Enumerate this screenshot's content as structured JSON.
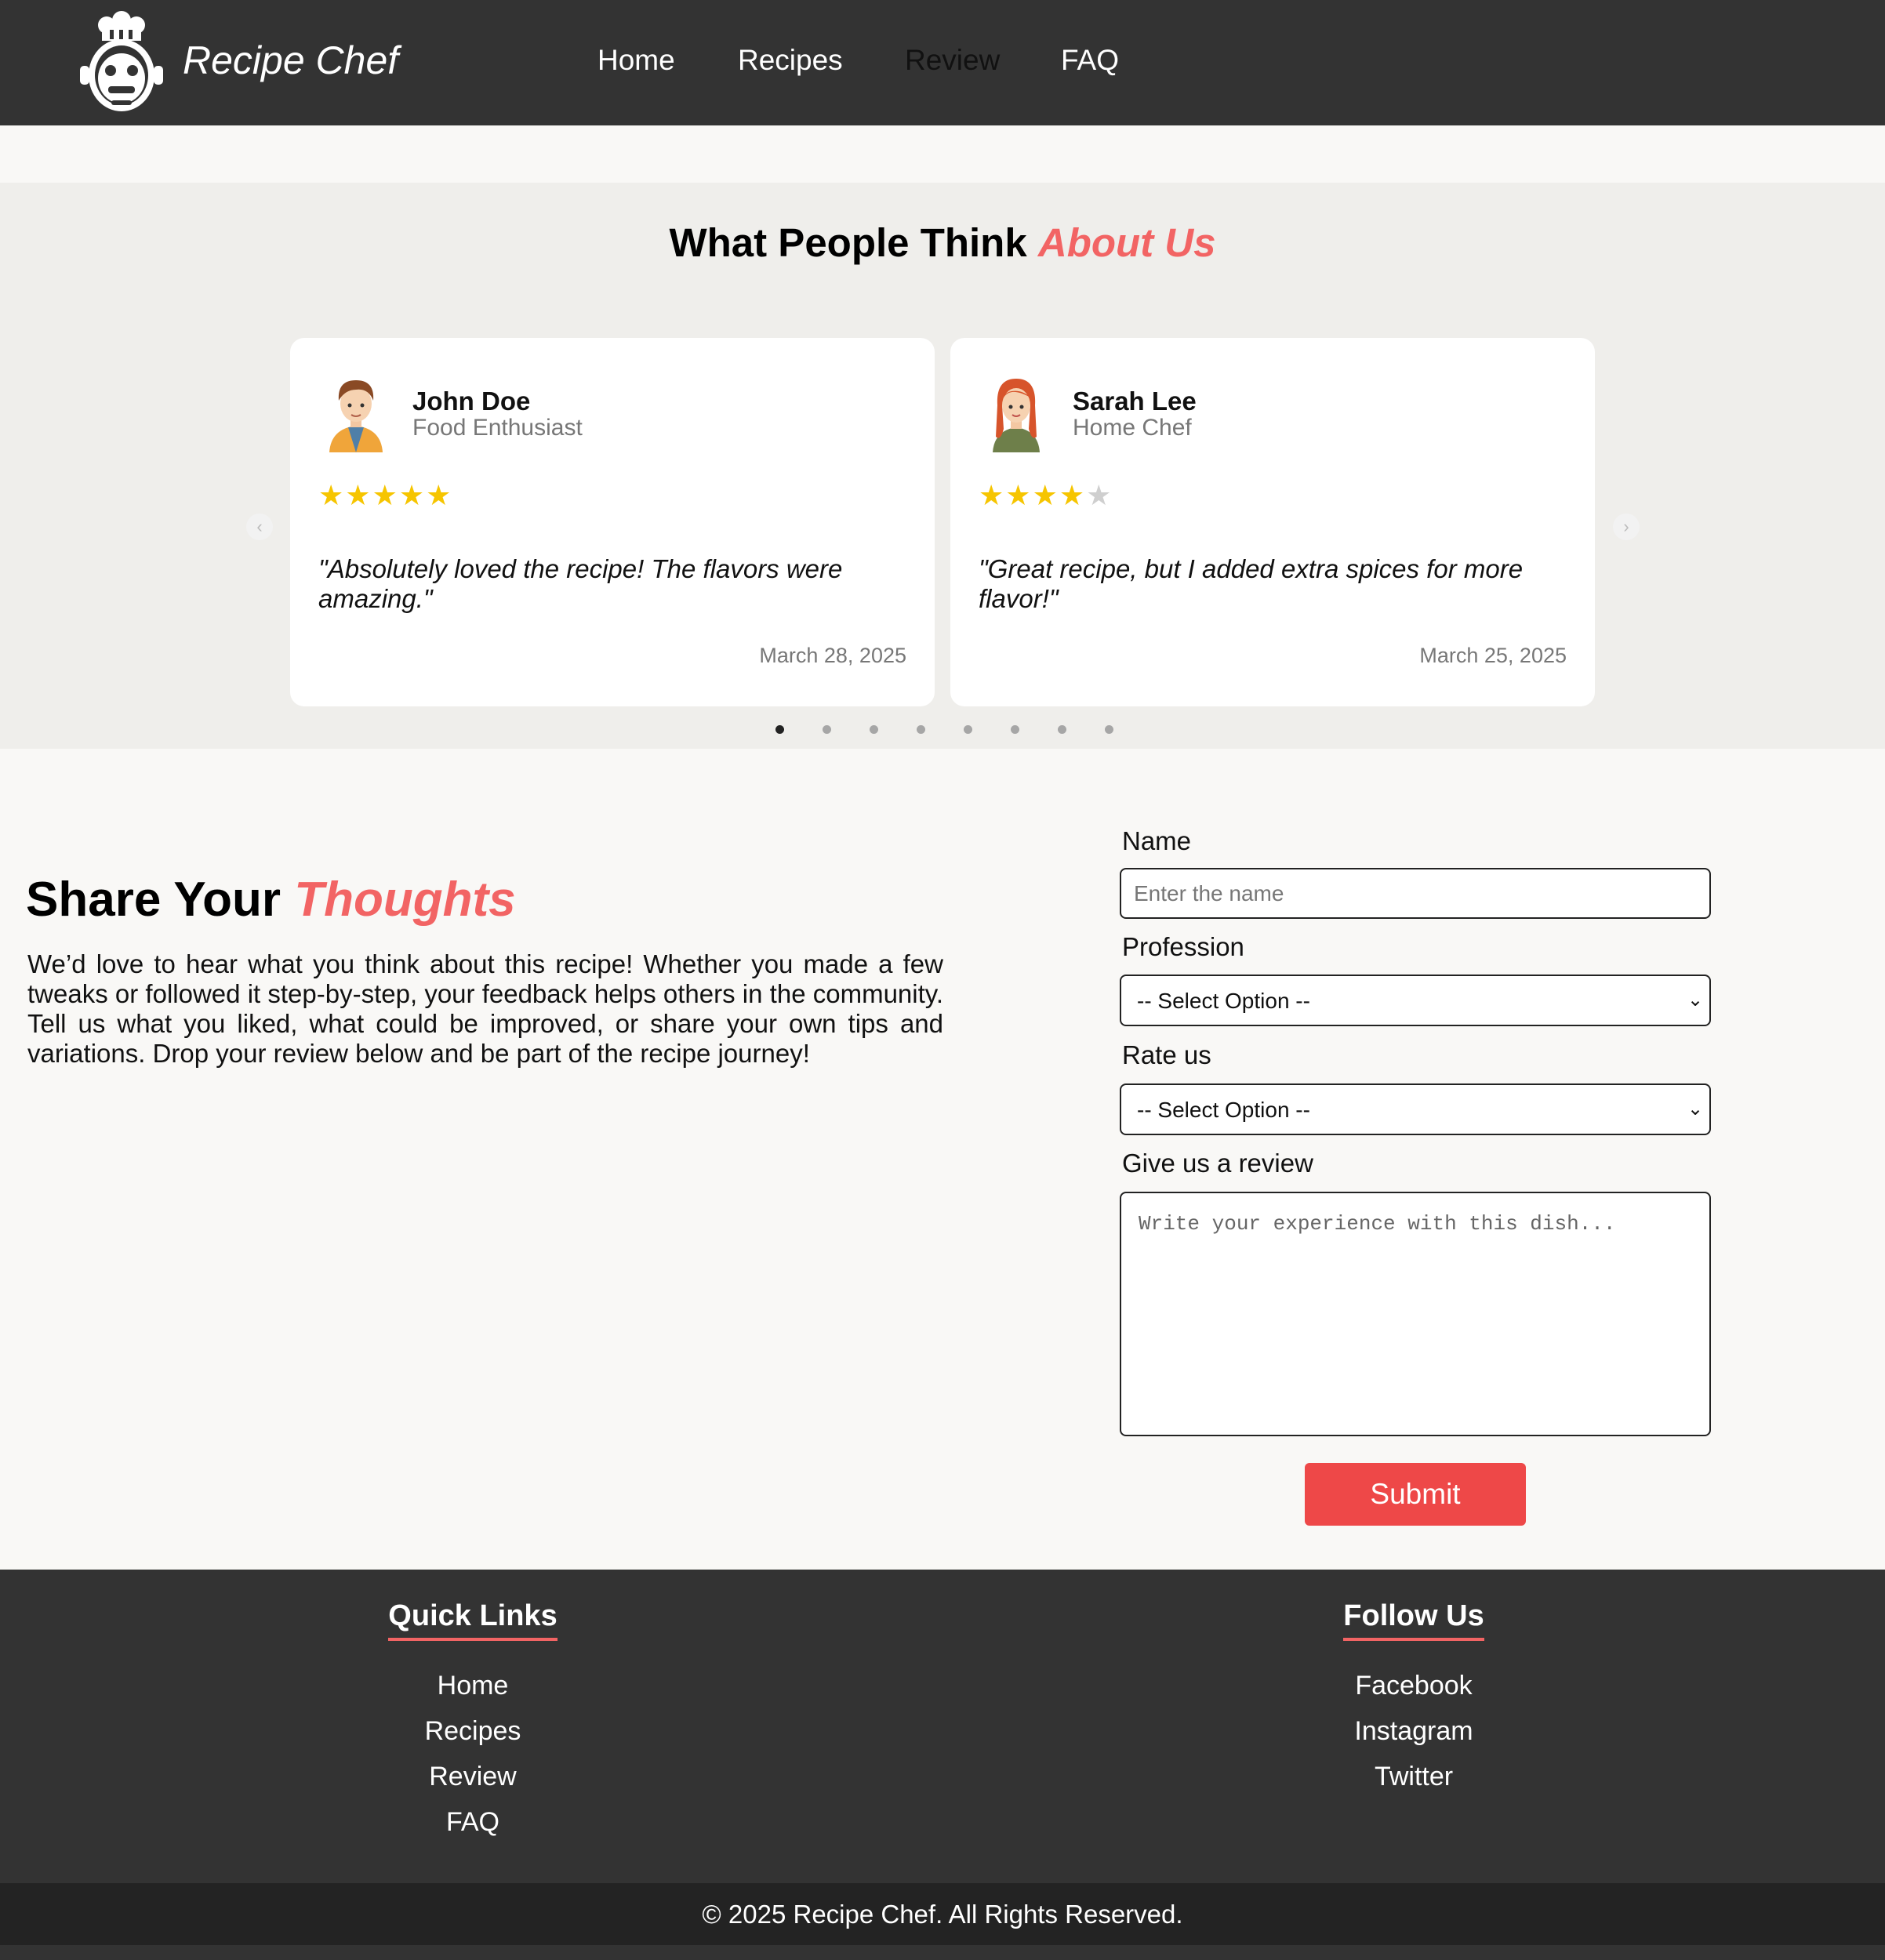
{
  "header": {
    "brand": "Recipe Chef",
    "nav": [
      {
        "label": "Home",
        "active": false
      },
      {
        "label": "Recipes",
        "active": false
      },
      {
        "label": "Review",
        "active": true
      },
      {
        "label": "FAQ",
        "active": false
      }
    ]
  },
  "testimonials": {
    "title_main": "What People Think ",
    "title_accent": "About Us",
    "accent_color": "#f26464",
    "cards": [
      {
        "name": "John Doe",
        "role": "Food Enthusiast",
        "rating": 5,
        "rating_max": 5,
        "quote": "\"Absolutely loved the recipe! The flavors were amazing.\"",
        "date": "March 28, 2025",
        "avatar": "male-avatar-icon"
      },
      {
        "name": "Sarah Lee",
        "role": "Home Chef",
        "rating": 4,
        "rating_max": 5,
        "quote": "\"Great recipe, but I added extra spices for more flavor!\"",
        "date": "March 25, 2025",
        "avatar": "female-avatar-icon"
      }
    ],
    "dots_count": 8,
    "active_dot": 0,
    "prev_icon": "chevron-left-icon",
    "next_icon": "chevron-right-icon"
  },
  "share": {
    "title_main": "Share Your ",
    "title_accent": "Thoughts",
    "text": "We’d love to hear what you think about this recipe! Whether you made a few tweaks or followed it step-by-step, your feedback helps others in the community. Tell us what you liked, what could be improved, or share your own tips and variations. Drop your review below and be part of the recipe journey!"
  },
  "form": {
    "name_label": "Name",
    "name_placeholder": "Enter the name",
    "profession_label": "Profession",
    "profession_selected": "-- Select Option --",
    "rate_label": "Rate us",
    "rate_selected": "-- Select Option --",
    "review_label": "Give us a review",
    "review_placeholder": "Write your experience with this dish...",
    "submit_label": "Submit",
    "submit_color": "#ee4848"
  },
  "footer": {
    "quick_links_title": "Quick Links",
    "quick_links": [
      "Home",
      "Recipes",
      "Review",
      "FAQ"
    ],
    "follow_title": "Follow Us",
    "follow_links": [
      "Facebook",
      "Instagram",
      "Twitter"
    ],
    "copyright": "© 2025 Recipe Chef. All Rights Reserved."
  }
}
